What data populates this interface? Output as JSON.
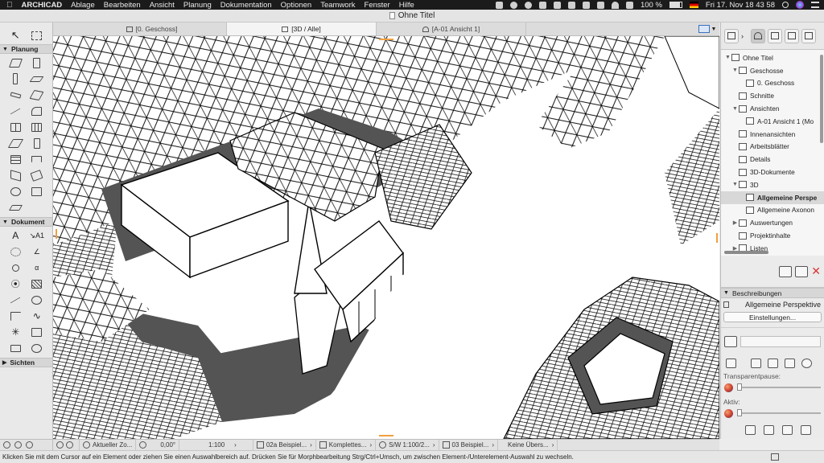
{
  "menubar": {
    "apple": "",
    "app_name": "ARCHICAD",
    "items": [
      "Ablage",
      "Bearbeiten",
      "Ansicht",
      "Planung",
      "Dokumentation",
      "Optionen",
      "Teamwork",
      "Fenster",
      "Hilfe"
    ],
    "battery": "100 %",
    "datetime": "Fri 17. Nov  18 43 58"
  },
  "window": {
    "title": "Ohne Titel"
  },
  "tabs": [
    {
      "label": "[0. Geschoss]",
      "active": false
    },
    {
      "label": "[3D / Alle]",
      "active": true
    },
    {
      "label": "[A-01 Ansicht 1]",
      "active": false
    }
  ],
  "toolbox": {
    "sections": [
      "Planung",
      "Dokument",
      "Sichten"
    ]
  },
  "navigator": {
    "tree": [
      {
        "label": "Ohne Titel",
        "level": 0,
        "twisty": "open",
        "icon": "project-icon"
      },
      {
        "label": "Geschosse",
        "level": 1,
        "twisty": "open",
        "icon": "stories-icon"
      },
      {
        "label": "0. Geschoss",
        "level": 2,
        "twisty": "",
        "icon": "story-icon"
      },
      {
        "label": "Schnitte",
        "level": 1,
        "twisty": "",
        "icon": "section-icon"
      },
      {
        "label": "Ansichten",
        "level": 1,
        "twisty": "open",
        "icon": "elevation-icon"
      },
      {
        "label": "A-01 Ansicht 1 (Mo",
        "level": 2,
        "twisty": "",
        "icon": "elevation-view-icon"
      },
      {
        "label": "Innenansichten",
        "level": 1,
        "twisty": "",
        "icon": "interior-elevation-icon"
      },
      {
        "label": "Arbeitsblätter",
        "level": 1,
        "twisty": "",
        "icon": "worksheet-icon"
      },
      {
        "label": "Details",
        "level": 1,
        "twisty": "",
        "icon": "detail-icon"
      },
      {
        "label": "3D-Dokumente",
        "level": 1,
        "twisty": "",
        "icon": "3d-document-icon"
      },
      {
        "label": "3D",
        "level": 1,
        "twisty": "open",
        "icon": "3d-icon"
      },
      {
        "label": "Allgemeine Perspe",
        "level": 2,
        "twisty": "",
        "icon": "perspective-icon",
        "selected": true
      },
      {
        "label": "Allgemeine Axonon",
        "level": 2,
        "twisty": "",
        "icon": "axonometry-icon"
      },
      {
        "label": "Auswertungen",
        "level": 1,
        "twisty": "closed",
        "icon": "schedule-icon"
      },
      {
        "label": "Projektinhalte",
        "level": 1,
        "twisty": "",
        "icon": "project-index-icon"
      },
      {
        "label": "Listen",
        "level": 1,
        "twisty": "closed",
        "icon": "list-icon"
      }
    ]
  },
  "info": {
    "section_title": "Beschreibungen",
    "selected_view": "Allgemeine Perspektive",
    "settings_button": "Einstellungen...",
    "transparency_label": "Transparentpause:",
    "active_label": "Aktiv:"
  },
  "viewbar": {
    "zoom_label": "Aktueller Zo...",
    "angle": "0,00°",
    "scale": "1:100",
    "layer_combo": "02a Beispiel...",
    "model_view": "Komplettes...",
    "pen_set": "S/W 1:100/2...",
    "dimension": "03 Beispiel...",
    "override": "Keine Übers..."
  },
  "statusbar": {
    "message": "Klicken Sie mit dem Cursor auf ein Element oder ziehen Sie einen Auswahlbereich auf. Drücken Sie für Morphbearbeitung Strg/Ctrl+Umsch, um zwischen Element-/Unterelement-Auswahl zu wechseln."
  },
  "colors": {
    "menubar": "#1b1b1b",
    "shadow": "#545454",
    "building_fill": "#ffffff",
    "building_stroke": "#000000",
    "accent_orange": "#f0a040"
  }
}
